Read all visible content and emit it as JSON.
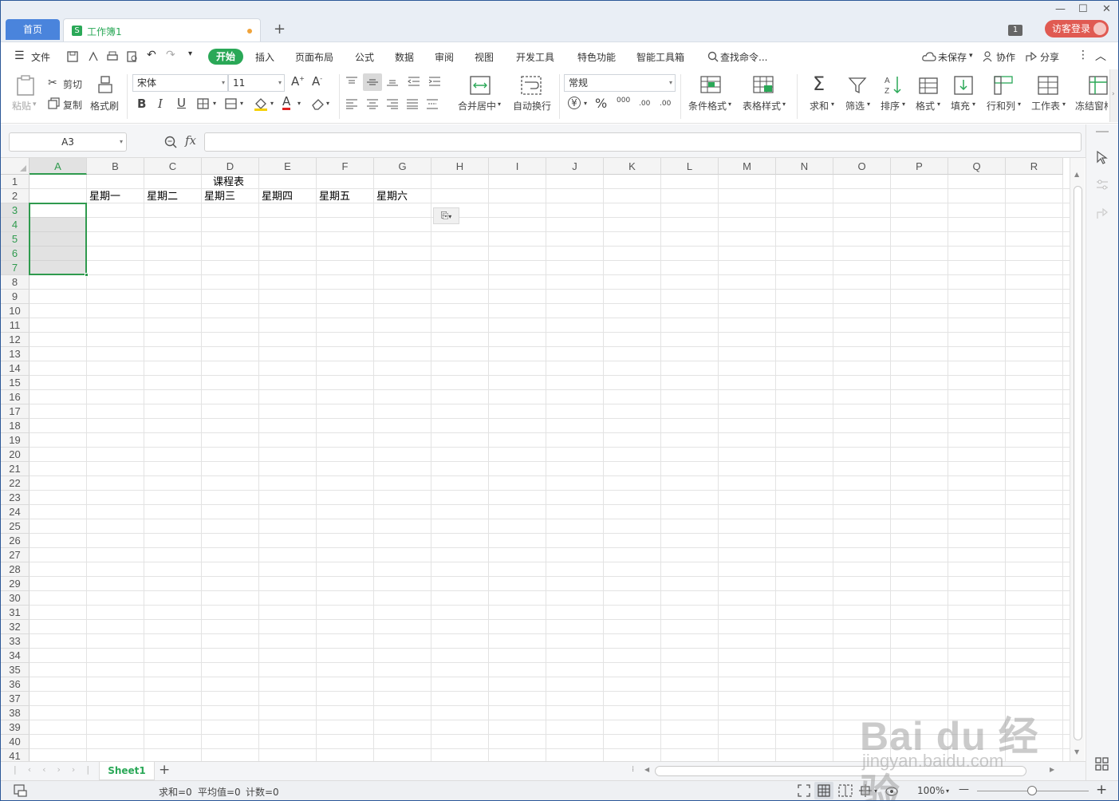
{
  "titlebar": {
    "home_tab": "首页",
    "doc_tab": "工作簿1",
    "doc_icon": "S",
    "new_tab": "+",
    "window_count": "1",
    "login": "访客登录",
    "min": "—",
    "max": "☐",
    "close": "✕"
  },
  "menu": {
    "file": "文件",
    "start": "开始",
    "items": [
      "插入",
      "页面布局",
      "公式",
      "数据",
      "审阅",
      "视图",
      "开发工具",
      "特色功能",
      "智能工具箱"
    ],
    "search": "查找命令...",
    "unsaved": "未保存",
    "collab": "协作",
    "share": "分享"
  },
  "toolbar": {
    "paste": "粘贴",
    "cut": "剪切",
    "copy": "复制",
    "format_painter": "格式刷",
    "font_name": "宋体",
    "font_size": "11",
    "bold": "B",
    "italic": "I",
    "underline": "U",
    "merge_center": "合并居中",
    "wrap": "自动换行",
    "number_format": "常规",
    "currency": "¥",
    "percent": "%",
    "thousands": "000",
    "inc_decimal": ".00",
    "dec_decimal": ".00",
    "cond_format": "条件格式",
    "table_style": "表格样式",
    "sum": "求和",
    "filter": "筛选",
    "sort": "排序",
    "format": "格式",
    "fill": "填充",
    "row_col": "行和列",
    "worksheet": "工作表",
    "freeze": "冻结窗格"
  },
  "formula_bar": {
    "name_box": "A3",
    "fx": "fx",
    "formula": ""
  },
  "grid": {
    "columns": [
      "A",
      "B",
      "C",
      "D",
      "E",
      "F",
      "G",
      "H",
      "I",
      "J",
      "K",
      "L",
      "M",
      "N",
      "O",
      "P",
      "Q",
      "R"
    ],
    "rows": [
      "1",
      "2",
      "3",
      "4",
      "5",
      "6",
      "7",
      "8",
      "9",
      "10",
      "11",
      "12",
      "13",
      "14",
      "15",
      "16",
      "17",
      "18",
      "19",
      "20",
      "21",
      "22",
      "23",
      "24",
      "25",
      "26",
      "27",
      "28",
      "29",
      "30",
      "31",
      "32",
      "33",
      "34",
      "35",
      "36",
      "37",
      "38",
      "39",
      "40",
      "41"
    ],
    "title": "课程表",
    "weekdays": [
      "星期一",
      "星期二",
      "星期三",
      "星期四",
      "星期五",
      "星期六"
    ],
    "selected_range": "A3:A7",
    "active_cell": "A3"
  },
  "sheets": {
    "tabs": [
      "Sheet1"
    ],
    "add": "+"
  },
  "status": {
    "sum": "求和=0",
    "average": "平均值=0",
    "count": "计数=0",
    "zoom": "100%",
    "zoom_minus": "—",
    "zoom_plus": "+"
  },
  "watermark": {
    "brand": "Bai du 经验",
    "url": "jingyan.baidu.com"
  },
  "colors": {
    "accent_green": "#2aa857",
    "home_tab_blue": "#4a84dc",
    "login_red": "#e05a52",
    "selection_border": "#2f9a4e"
  }
}
